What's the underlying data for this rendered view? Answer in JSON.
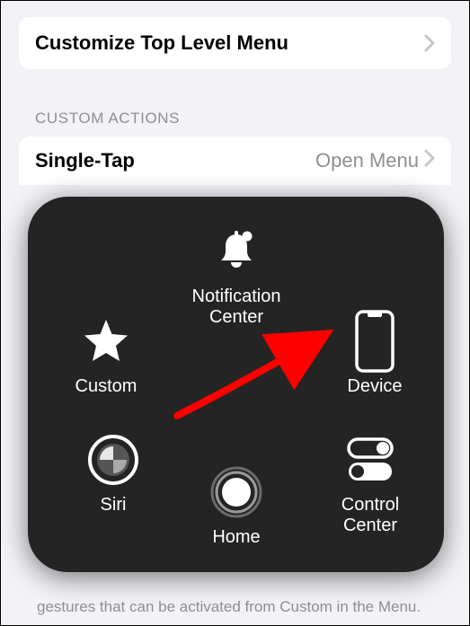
{
  "top_card": {
    "title": "Customize Top Level Menu"
  },
  "section_header": "CUSTOM ACTIONS",
  "row1": {
    "label": "Single-Tap",
    "value": "Open Menu"
  },
  "assistive": {
    "notification_center": "Notification Center",
    "custom": "Custom",
    "device": "Device",
    "siri": "Siri",
    "control_center": "Control Center",
    "home": "Home"
  },
  "footer": "gestures that can be activated from Custom in the Menu."
}
